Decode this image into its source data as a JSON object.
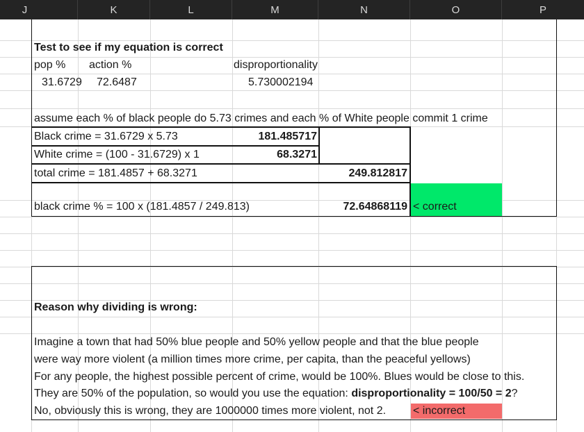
{
  "columns": [
    "J",
    "K",
    "L",
    "M",
    "N",
    "O",
    "P"
  ],
  "test_section": {
    "title": "Test to see if my equation is correct",
    "pop_label": "pop %",
    "action_label": "action %",
    "disproportionality_label": "disproportionality",
    "pop_value": "31.6729",
    "action_value": "72.6487",
    "disproportionality_value": "5.730002194",
    "assumption": "assume each % of black people do 5.73 crimes and each % of White people commit 1 crime",
    "black_crime_formula": "Black crime = 31.6729 x 5.73",
    "black_crime_value": "181.485717",
    "white_crime_formula": "White crime = (100 - 31.6729) x 1",
    "white_crime_value": "68.3271",
    "total_crime_formula": "total crime = 181.4857 + 68.3271",
    "total_crime_value": "249.812817",
    "black_pct_formula": "black crime % = 100 x (181.4857 / 249.813)",
    "black_pct_value": "72.64868119",
    "correct_note": "< correct",
    "correct_color": "#00e86a"
  },
  "reason_section": {
    "heading": "Reason why dividing is wrong:",
    "line1": "Imagine a town that had 50% blue people and 50% yellow people and that the blue people",
    "line2": "were way more violent (a million times more crime, per capita, than the peaceful yellows)",
    "line3": "For any people, the highest possible percent of crime, would be 100%. Blues would be close to this.",
    "line4_prefix": "They are 50% of the population, so would you use the equation: ",
    "line4_bold": "disproportionality = 100/50 = 2",
    "line4_suffix": "?",
    "line5": "No, obviously this is wrong, they are 1000000 times more violent, not 2.",
    "incorrect_note": "< incorrect",
    "incorrect_color": "#f36b6b"
  }
}
